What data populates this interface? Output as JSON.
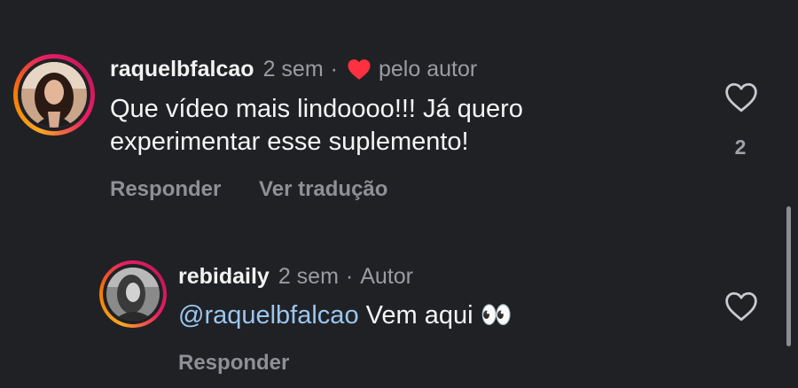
{
  "comments": [
    {
      "username": "raquelbfalcao",
      "time": "2 sem",
      "separator": "·",
      "liked_by_author_label": "pelo autor",
      "text_line1": "Que vídeo mais lindoooo!!! Já quero",
      "text_line2": "experimentar esse suplemento!",
      "reply_label": "Responder",
      "translate_label": "Ver tradução",
      "like_count": "2"
    },
    {
      "username": "rebidaily",
      "time": "2 sem",
      "separator": "·",
      "author_badge": "Autor",
      "mention": "@raquelbfalcao",
      "text": " Vem aqui ",
      "emoji": "👀",
      "reply_label": "Responder"
    }
  ],
  "colors": {
    "background": "#202125",
    "heart_red": "#ff3040",
    "mention_blue": "#9bc6ee",
    "muted_gray": "#9a9ca2"
  },
  "icons": [
    "heart-filled-icon",
    "heart-outline-icon"
  ]
}
